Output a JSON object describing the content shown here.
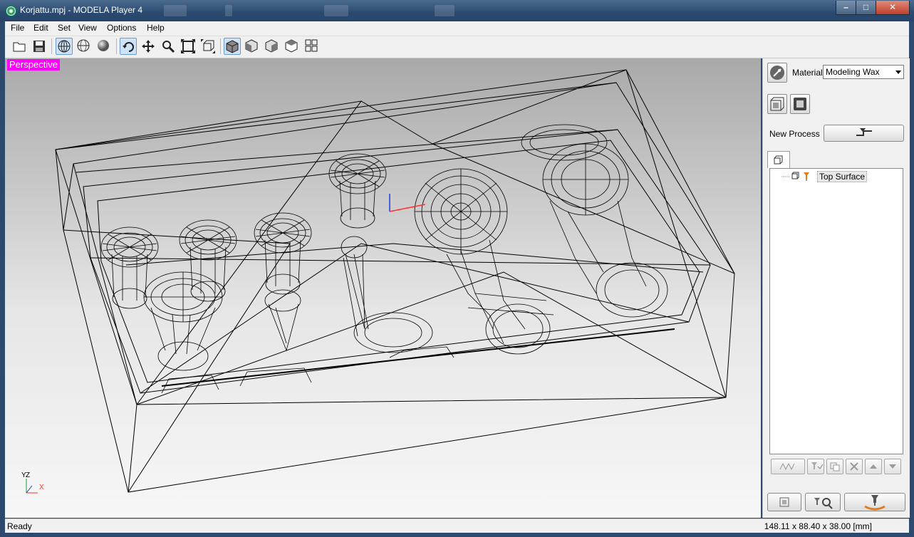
{
  "window": {
    "title": "Korjattu.mpj - MODELA Player 4",
    "minimize_label": "–",
    "maximize_label": "□",
    "close_label": "✕"
  },
  "menu": {
    "items": [
      {
        "label": "File"
      },
      {
        "label": "Edit"
      },
      {
        "label": "Set"
      },
      {
        "label": "View"
      },
      {
        "label": "Options"
      },
      {
        "label": "Help"
      }
    ]
  },
  "toolbar": {
    "buttons": [
      {
        "icon": "open-folder-icon"
      },
      {
        "icon": "save-disk-icon"
      },
      {
        "icon": "wireframe-globe-icon",
        "active": true
      },
      {
        "icon": "hidden-line-globe-icon"
      },
      {
        "icon": "shaded-sphere-icon"
      },
      {
        "icon": "rotate-view-icon",
        "active": true
      },
      {
        "icon": "pan-view-icon"
      },
      {
        "icon": "zoom-view-icon"
      },
      {
        "icon": "fit-view-icon"
      },
      {
        "icon": "fit-model-icon"
      },
      {
        "icon": "iso-view-icon",
        "active": true
      },
      {
        "icon": "front-view-icon"
      },
      {
        "icon": "right-view-icon"
      },
      {
        "icon": "left-view-icon"
      },
      {
        "icon": "multi-view-icon"
      }
    ]
  },
  "viewport": {
    "view_mode": "Perspective",
    "axis": {
      "z": "Z",
      "y": "Y",
      "x": "X"
    }
  },
  "panel": {
    "material_label": "Material",
    "material_value": "Modeling Wax",
    "new_process_label": "New Process",
    "process_tree": [
      {
        "label": "Top Surface"
      }
    ]
  },
  "status": {
    "left": "Ready",
    "dimensions": "148.11 x 88.40 x 38.00 [mm]"
  },
  "colors": {
    "view_label_bg": "#ff00ff",
    "axis_x": "#ff3030",
    "axis_z": "#1d3fd0",
    "process_icon": "#e07b20"
  }
}
